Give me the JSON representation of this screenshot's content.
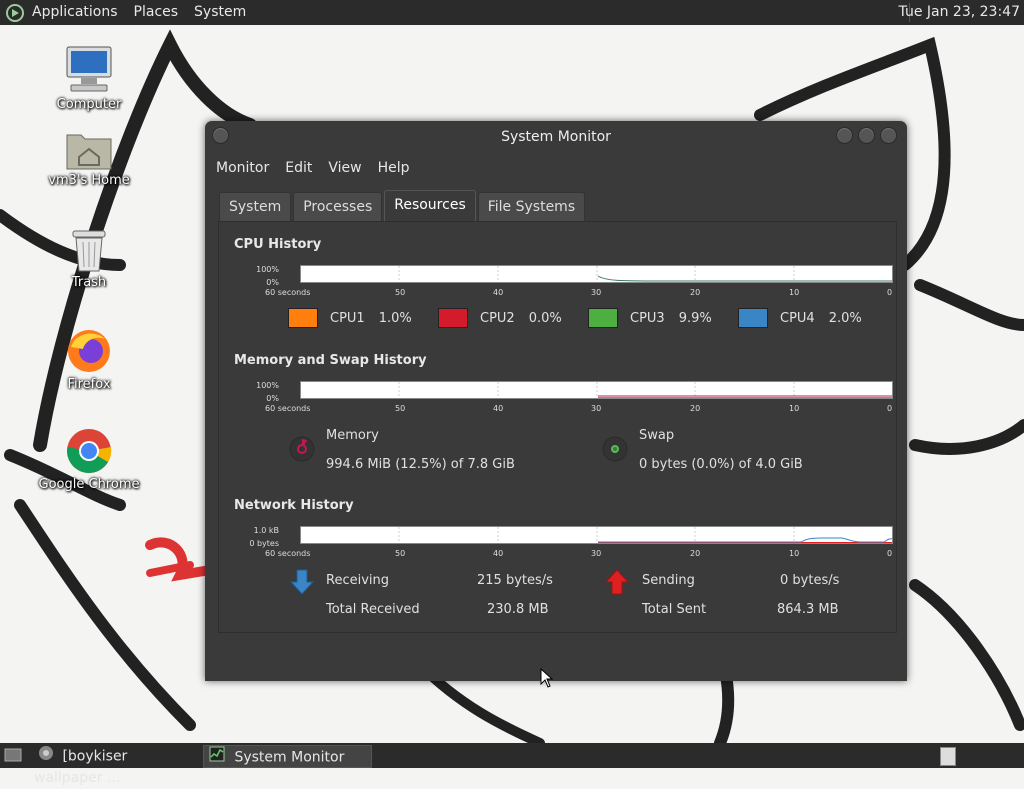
{
  "top_panel": {
    "menus": [
      "Applications",
      "Places",
      "System"
    ],
    "clock": "Tue Jan 23, 23:47"
  },
  "desktop_icons": [
    {
      "label": "Computer",
      "icon": "computer-icon"
    },
    {
      "label": "vm3's Home",
      "icon": "home-folder-icon"
    },
    {
      "label": "Trash",
      "icon": "trash-icon"
    },
    {
      "label": "Firefox",
      "icon": "firefox-icon"
    },
    {
      "label": "Google Chrome",
      "icon": "chrome-icon"
    }
  ],
  "window": {
    "title": "System Monitor",
    "menus": [
      "Monitor",
      "Edit",
      "View",
      "Help"
    ],
    "tabs": [
      "System",
      "Processes",
      "Resources",
      "File Systems"
    ],
    "active_tab": "Resources"
  },
  "axis": {
    "x_ticks": [
      "60 seconds",
      "50",
      "40",
      "30",
      "20",
      "10",
      "0"
    ]
  },
  "cpu": {
    "title": "CPU History",
    "y_top": "100%",
    "y_bottom": "0%",
    "cores": [
      {
        "name": "CPU1",
        "value": "1.0%",
        "color": "#ff7f0e"
      },
      {
        "name": "CPU2",
        "value": "0.0%",
        "color": "#d31b2b"
      },
      {
        "name": "CPU3",
        "value": "9.9%",
        "color": "#4caf3f"
      },
      {
        "name": "CPU4",
        "value": "2.0%",
        "color": "#3a85c6"
      }
    ]
  },
  "memory": {
    "title": "Memory and Swap History",
    "y_top": "100%",
    "y_bottom": "0%",
    "memory_label": "Memory",
    "memory_value": "994.6 MiB (12.5%) of 7.8 GiB",
    "memory_color": "#c2185b",
    "swap_label": "Swap",
    "swap_value": "0 bytes (0.0%) of 4.0 GiB",
    "swap_color": "#5cb85c"
  },
  "network": {
    "title": "Network History",
    "y_top": "1.0 kB",
    "y_bottom": "0 bytes",
    "receiving_label": "Receiving",
    "receiving_value": "215 bytes/s",
    "total_received_label": "Total Received",
    "total_received_value": "230.8 MB",
    "sending_label": "Sending",
    "sending_value": "0 bytes/s",
    "total_sent_label": "Total Sent",
    "total_sent_value": "864.3 MB",
    "receiving_color": "#3a85c6",
    "sending_color": "#e02020"
  },
  "taskbar": {
    "tasks": [
      "[boykiser wallpaper ...",
      "System Monitor"
    ]
  }
}
